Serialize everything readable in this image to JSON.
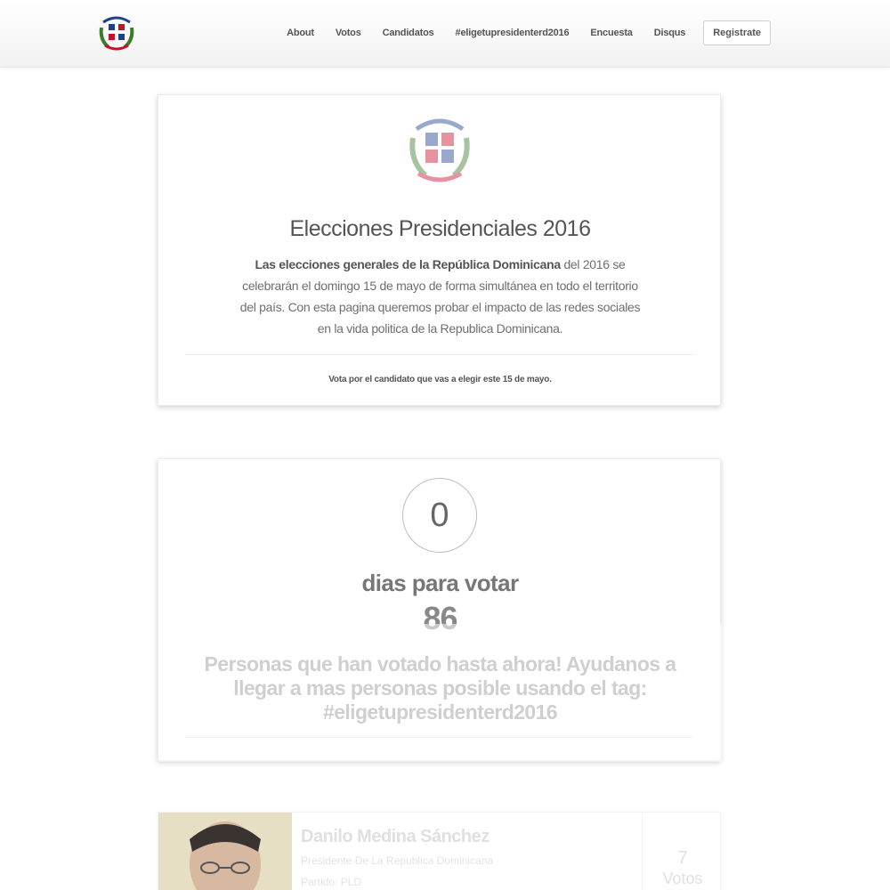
{
  "nav": {
    "links": [
      "About",
      "Votos",
      "Candidatos",
      "#eligetupresidenterd2016",
      "Encuesta",
      "Disqus"
    ],
    "register_label": "Registrate"
  },
  "intro": {
    "title": "Elecciones Presidenciales 2016",
    "text_bold": "Las elecciones generales de la República Dominicana",
    "text_rest": " del 2016 se celebrarán el domingo 15 de mayo de forma simultánea en todo el territorio del país. Con esta pagina queremos probar el impacto de las redes sociales en la vida politica de la Republica Dominicana.",
    "footer_text": "Vota por el candidato que vas a elegir este ",
    "footer_bold": "15 de mayo."
  },
  "counter": {
    "days_value": "0",
    "days_label": "dias para votar",
    "votes_count": "86",
    "message": "Personas que han votado hasta ahora! Ayudanos a llegar a mas personas posible usando el tag: #eligetupresidenterd2016"
  },
  "candidate": {
    "name": "Danilo Medina Sánchez",
    "role": "Presidente De La Republica Dominicana",
    "party": "Partido: PLD",
    "votes": "7",
    "votes_label": "Votos"
  },
  "icons": {
    "nav_logo": "coat-of-arms-icon",
    "card_logo": "coat-of-arms-icon"
  },
  "colors": {
    "flag_blue": "#1f3f8f",
    "flag_red": "#c8102e",
    "laurel_green": "#3a7d2c"
  }
}
